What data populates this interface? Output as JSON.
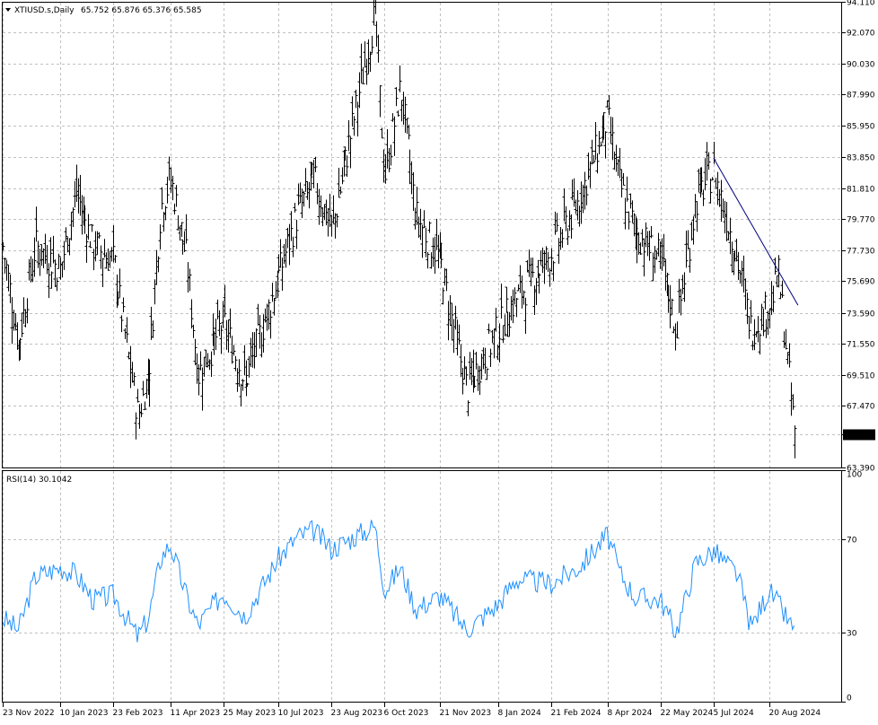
{
  "chart_data": [
    {
      "type": "bar",
      "subtype": "ohlc",
      "title": "XTIUSD.s,Daily",
      "header_values": "65.752 65.876 65.376 65.585",
      "current_price": 65.585,
      "ylim": [
        63.39,
        94.111
      ],
      "y_ticks": [
        "94.110",
        "92.070",
        "90.030",
        "87.990",
        "85.950",
        "83.850",
        "81.810",
        "79.770",
        "77.730",
        "75.690",
        "73.590",
        "71.550",
        "69.510",
        "67.470",
        "65.585",
        "63.390"
      ],
      "x_ticks": [
        "23 Nov 2022",
        "10 Jan 2023",
        "23 Feb 2023",
        "11 Apr 2023",
        "25 May 2023",
        "10 Jul 2023",
        "23 Aug 2023",
        "6 Oct 2023",
        "21 Nov 2023",
        "8 Jan 2024",
        "21 Feb 2024",
        "8 Apr 2024",
        "22 May 2024",
        "5 Jul 2024",
        "20 Aug 2024"
      ],
      "grid": true,
      "price_path": [
        {
          "x": "23 Nov 2022",
          "y": 78
        },
        {
          "x": "6 Dec 2022",
          "y": 71.5
        },
        {
          "x": "20 Dec 2022",
          "y": 78
        },
        {
          "x": "10 Jan 2023",
          "y": 76.5
        },
        {
          "x": "23 Jan 2023",
          "y": 81.5
        },
        {
          "x": "6 Feb 2023",
          "y": 78
        },
        {
          "x": "23 Feb 2023",
          "y": 77
        },
        {
          "x": "15 Mar 2023",
          "y": 66.8
        },
        {
          "x": "24 Mar 2023",
          "y": 69.5
        },
        {
          "x": "3 Apr 2023",
          "y": 80.5
        },
        {
          "x": "11 Apr 2023",
          "y": 82.5
        },
        {
          "x": "25 Apr 2023",
          "y": 77
        },
        {
          "x": "4 May 2023",
          "y": 69.5
        },
        {
          "x": "25 May 2023",
          "y": 73
        },
        {
          "x": "12 Jun 2023",
          "y": 69
        },
        {
          "x": "10 Jul 2023",
          "y": 76
        },
        {
          "x": "25 Jul 2023",
          "y": 80
        },
        {
          "x": "8 Aug 2023",
          "y": 82.5
        },
        {
          "x": "23 Aug 2023",
          "y": 79
        },
        {
          "x": "28 Sep 2023",
          "y": 93.5
        },
        {
          "x": "6 Oct 2023",
          "y": 82.5
        },
        {
          "x": "19 Oct 2023",
          "y": 88.5
        },
        {
          "x": "1 Nov 2023",
          "y": 80
        },
        {
          "x": "21 Nov 2023",
          "y": 77
        },
        {
          "x": "13 Dec 2023",
          "y": 68.5
        },
        {
          "x": "8 Jan 2024",
          "y": 72.5
        },
        {
          "x": "23 Jan 2024",
          "y": 74.5
        },
        {
          "x": "21 Feb 2024",
          "y": 77.5
        },
        {
          "x": "15 Mar 2024",
          "y": 81
        },
        {
          "x": "8 Apr 2024",
          "y": 86.5
        },
        {
          "x": "18 Apr 2024",
          "y": 82
        },
        {
          "x": "1 May 2024",
          "y": 79
        },
        {
          "x": "22 May 2024",
          "y": 77
        },
        {
          "x": "4 Jun 2024",
          "y": 72.5
        },
        {
          "x": "20 Jun 2024",
          "y": 81
        },
        {
          "x": "5 Jul 2024",
          "y": 83
        },
        {
          "x": "25 Jul 2024",
          "y": 77
        },
        {
          "x": "5 Aug 2024",
          "y": 72.5
        },
        {
          "x": "20 Aug 2024",
          "y": 74
        },
        {
          "x": "28 Aug 2024",
          "y": 76
        },
        {
          "x": "10 Sep 2024",
          "y": 65.6
        }
      ],
      "trendline": {
        "from": {
          "x": "5 Jul 2024",
          "y": 83.8
        },
        "to": {
          "x": "13 Sep 2024",
          "y": 74.1
        }
      }
    },
    {
      "type": "line",
      "title": "RSI(14) 30.1042",
      "ylim": [
        0,
        100
      ],
      "y_ticks": [
        "100",
        "70",
        "30",
        "0"
      ],
      "levels": [
        70,
        30
      ],
      "color": "#1e90ff",
      "x": [
        "23 Nov 2022",
        "6 Dec 2022",
        "20 Dec 2022",
        "10 Jan 2023",
        "23 Jan 2023",
        "6 Feb 2023",
        "23 Feb 2023",
        "15 Mar 2023",
        "24 Mar 2023",
        "3 Apr 2023",
        "11 Apr 2023",
        "25 Apr 2023",
        "4 May 2023",
        "25 May 2023",
        "12 Jun 2023",
        "10 Jul 2023",
        "25 Jul 2023",
        "8 Aug 2023",
        "23 Aug 2023",
        "28 Sep 2023",
        "6 Oct 2023",
        "19 Oct 2023",
        "1 Nov 2023",
        "21 Nov 2023",
        "13 Dec 2023",
        "8 Jan 2024",
        "23 Jan 2024",
        "21 Feb 2024",
        "15 Mar 2024",
        "8 Apr 2024",
        "18 Apr 2024",
        "1 May 2024",
        "22 May 2024",
        "4 Jun 2024",
        "20 Jun 2024",
        "5 Jul 2024",
        "25 Jul 2024",
        "5 Aug 2024",
        "20 Aug 2024",
        "28 Aug 2024",
        "10 Sep 2024"
      ],
      "values": [
        36,
        31,
        54,
        58,
        55,
        44,
        46,
        28,
        36,
        62,
        68,
        45,
        33,
        47,
        37,
        62,
        71,
        74,
        66,
        76,
        48,
        58,
        40,
        46,
        31,
        42,
        53,
        51,
        58,
        72,
        56,
        45,
        44,
        30,
        60,
        65,
        55,
        32,
        48,
        42,
        30
      ]
    }
  ]
}
